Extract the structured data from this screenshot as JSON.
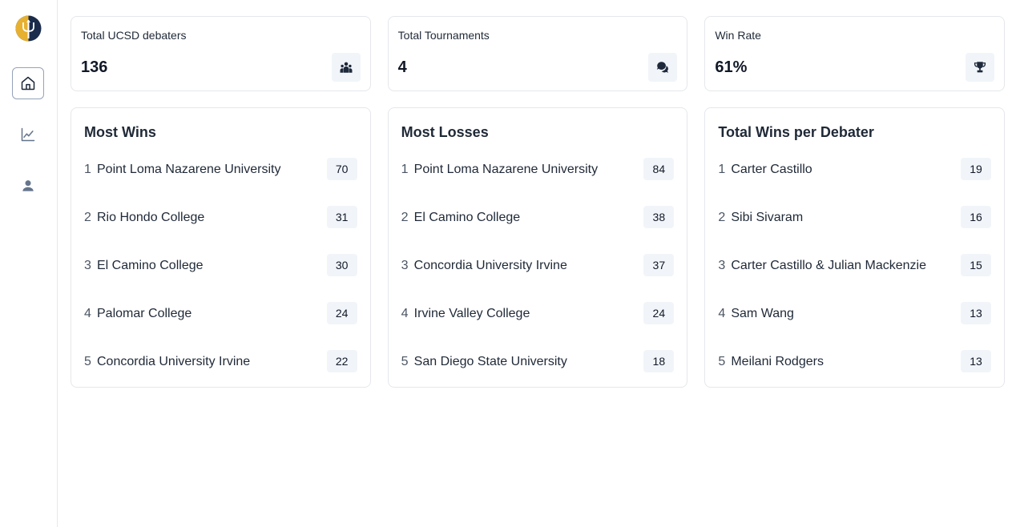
{
  "sidebar": {
    "logo_icon": "trident-logo-icon",
    "nav": [
      {
        "icon": "home-icon",
        "active": true
      },
      {
        "icon": "line-chart-icon",
        "active": false
      },
      {
        "icon": "user-icon",
        "active": false
      }
    ]
  },
  "stats": [
    {
      "label": "Total UCSD debaters",
      "value": "136",
      "icon": "users-icon"
    },
    {
      "label": "Total Tournaments",
      "value": "4",
      "icon": "chat-bubbles-icon"
    },
    {
      "label": "Win Rate",
      "value": "61%",
      "icon": "trophy-icon"
    }
  ],
  "most_wins": {
    "title": "Most Wins",
    "items": [
      {
        "rank": "1",
        "name": "Point Loma Nazarene University",
        "count": "70"
      },
      {
        "rank": "2",
        "name": "Rio Hondo College",
        "count": "31"
      },
      {
        "rank": "3",
        "name": "El Camino College",
        "count": "30"
      },
      {
        "rank": "4",
        "name": "Palomar College",
        "count": "24"
      },
      {
        "rank": "5",
        "name": "Concordia University Irvine",
        "count": "22"
      }
    ]
  },
  "most_losses": {
    "title": "Most Losses",
    "items": [
      {
        "rank": "1",
        "name": "Point Loma Nazarene University",
        "count": "84"
      },
      {
        "rank": "2",
        "name": "El Camino College",
        "count": "38"
      },
      {
        "rank": "3",
        "name": "Concordia University Irvine",
        "count": "37"
      },
      {
        "rank": "4",
        "name": "Irvine Valley College",
        "count": "24"
      },
      {
        "rank": "5",
        "name": "San Diego State University",
        "count": "18"
      }
    ]
  },
  "wins_per_debater": {
    "title": "Total Wins per Debater",
    "items": [
      {
        "rank": "1",
        "name": "Carter Castillo",
        "count": "19"
      },
      {
        "rank": "2",
        "name": "Sibi Sivaram",
        "count": "16"
      },
      {
        "rank": "3",
        "name": "Carter Castillo & Julian Mackenzie",
        "count": "15"
      },
      {
        "rank": "4",
        "name": "Sam Wang",
        "count": "13"
      },
      {
        "rank": "5",
        "name": "Meilani Rodgers",
        "count": "13"
      }
    ]
  },
  "colors": {
    "logo_gold": "#e6b031",
    "logo_navy": "#1a2b4c",
    "badge_bg": "#f1f5f9",
    "border": "#e5e7eb"
  }
}
